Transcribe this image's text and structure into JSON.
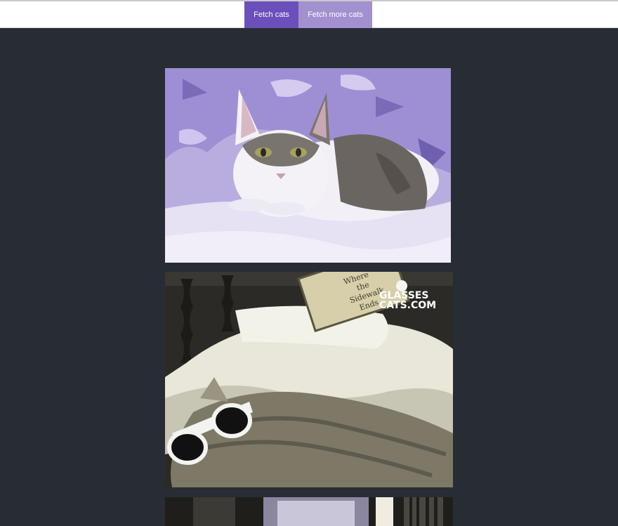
{
  "toolbar": {
    "fetch_label": "Fetch cats",
    "fetch_more_label": "Fetch more cats"
  },
  "cats": [
    {
      "name": "cat-photo-1",
      "subject": "white and grey cat lying on purple-patterned blanket"
    },
    {
      "name": "cat-photo-2",
      "subject": "tabby cat wearing white sunglasses on bed with book",
      "watermark": "GLASSES CATS.COM",
      "book_title": "Where the Sidewalk Ends"
    },
    {
      "name": "cat-photo-3",
      "subject": "room interior with window and bookshelf"
    }
  ],
  "colors": {
    "background": "#282c34",
    "primary_button": "#6b4fbb",
    "secondary_button": "#a390cf"
  }
}
